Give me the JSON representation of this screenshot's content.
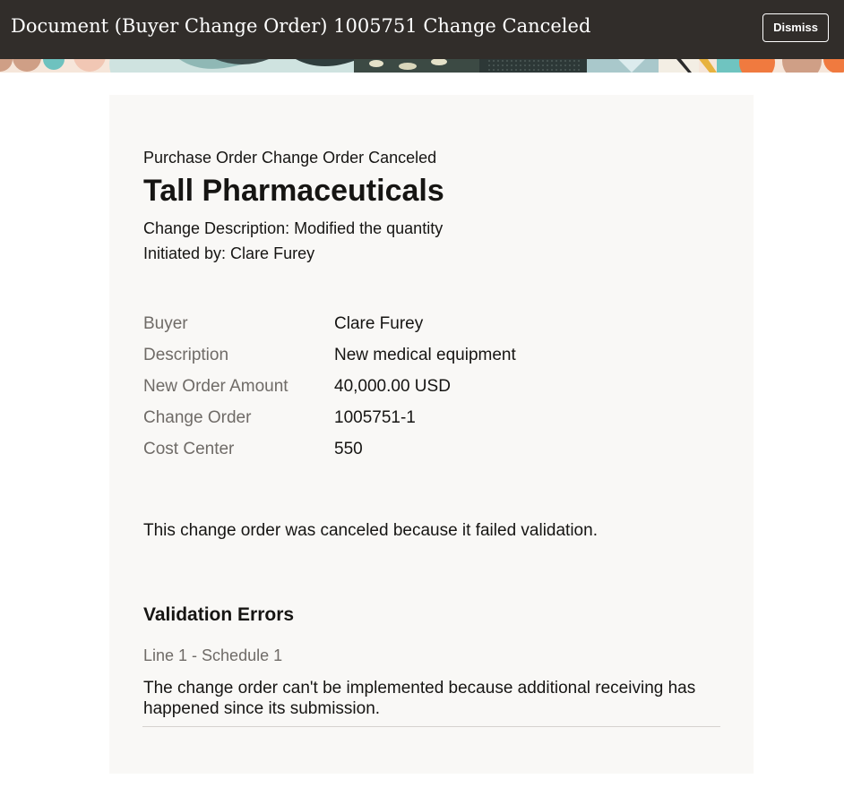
{
  "header": {
    "title": "Document (Buyer Change Order) 1005751 Change Canceled",
    "dismiss_label": "Dismiss"
  },
  "card": {
    "subtitle": "Purchase Order Change Order Canceled",
    "supplier": "Tall Pharmaceuticals",
    "change_description": "Change Description: Modified the quantity",
    "initiated_by": "Initiated by: Clare Furey",
    "details": [
      {
        "label": "Buyer",
        "value": "Clare Furey"
      },
      {
        "label": "Description",
        "value": "New medical equipment"
      },
      {
        "label": "New Order Amount",
        "value": "40,000.00 USD"
      },
      {
        "label": "Change Order",
        "value": "1005751-1"
      },
      {
        "label": "Cost Center",
        "value": "550"
      }
    ],
    "message": "This change order was canceled because it failed validation.",
    "validation": {
      "heading": "Validation Errors",
      "line": "Line 1 - Schedule 1",
      "error": "The change order can't be implemented because additional receiving has happened since its submission."
    }
  },
  "colors": {
    "header_bg": "#312d2a",
    "card_bg": "#f9f8f6",
    "label_text": "#6f6b67"
  }
}
